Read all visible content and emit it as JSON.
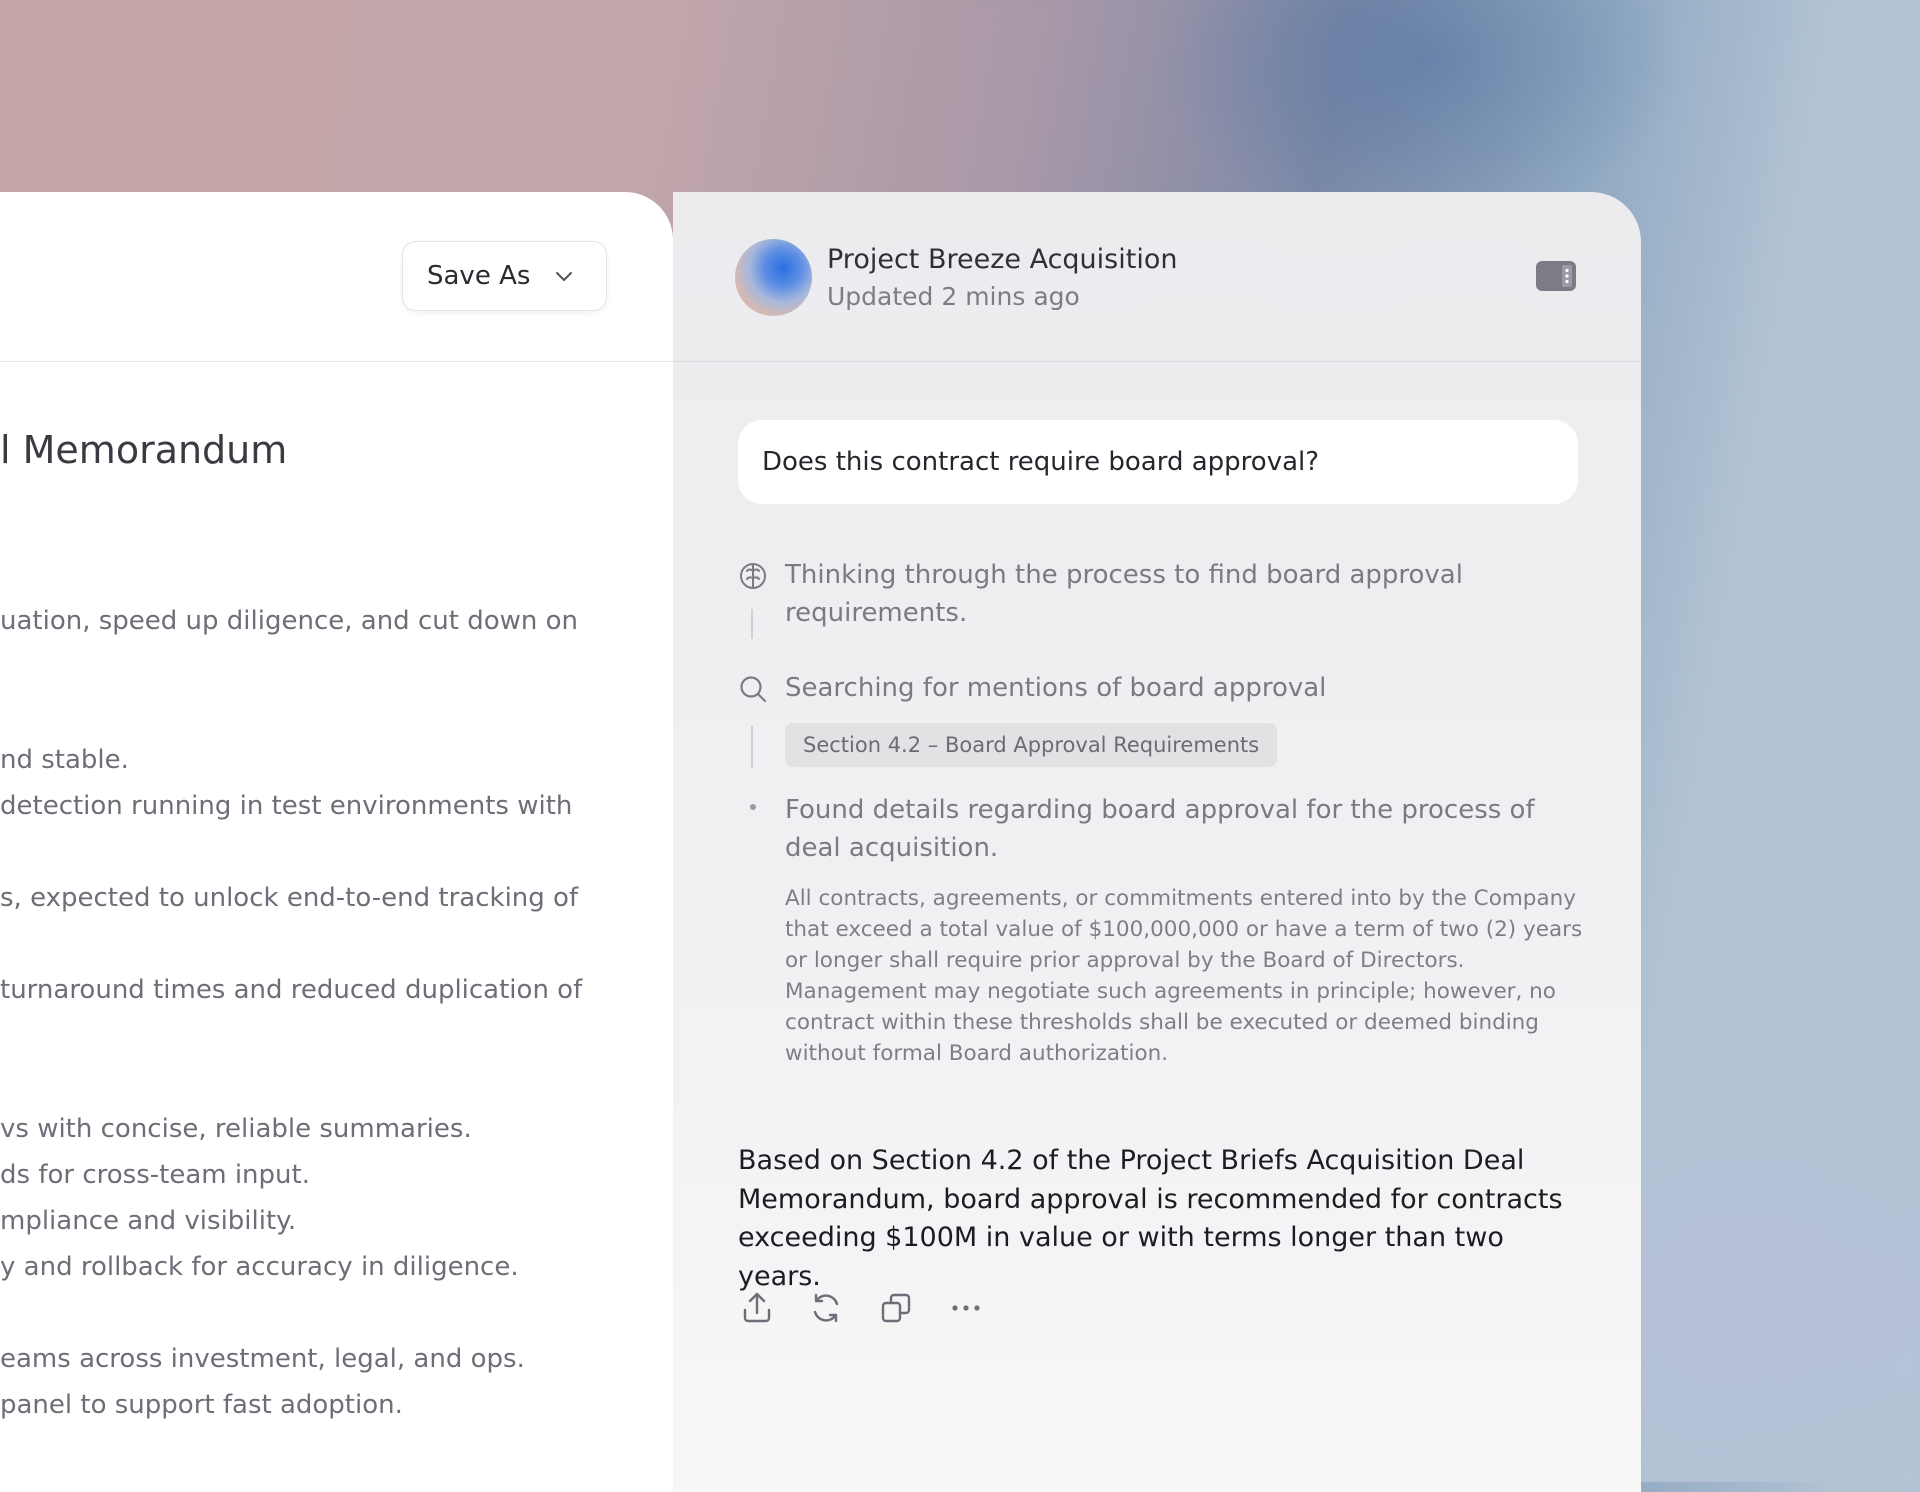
{
  "document": {
    "save_button_label": "Save As",
    "title": "l Memorandum",
    "lines": [
      "uation, speed up diligence, and cut down on",
      "nd stable.",
      " detection running in test environments with",
      "s, expected to unlock end-to-end tracking of",
      " turnaround times and reduced duplication of",
      "vs with concise, reliable summaries.",
      "ds for cross-team input.",
      "mpliance and visibility.",
      "y and rollback for accuracy in diligence.",
      "eams across investment, legal, and ops.",
      "panel to support fast adoption."
    ]
  },
  "chat": {
    "project_title": "Project Breeze Acquisition",
    "updated": "Updated 2 mins ago",
    "question": "Does this contract require board approval?",
    "steps": {
      "thinking": "Thinking through the process to find board approval requirements.",
      "searching": "Searching for mentions of board approval",
      "source_chip": "Section 4.2 – Board Approval Requirements",
      "found": "Found details regarding board approval for the process of deal acquisition.",
      "quote": "All contracts, agreements, or commitments entered into by the Company that exceed a total value of $100,000,000 or have a term of two (2) years or longer shall require prior approval by the Board of Directors. Management may negotiate such agreements in principle; however, no contract within these thresholds shall be executed or deemed binding without formal Board authorization."
    },
    "answer": "Based on Section 4.2 of the Project Briefs Acquisition Deal Memorandum, board approval is recommended for contracts exceeding $100M in value or with terms longer than two years.",
    "actions": [
      "share-icon",
      "regenerate-icon",
      "copy-icon",
      "more-icon"
    ]
  }
}
